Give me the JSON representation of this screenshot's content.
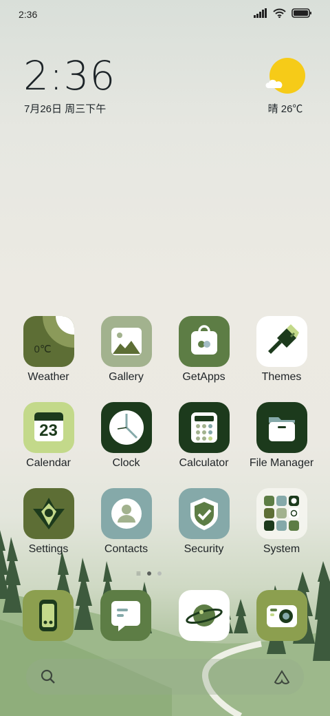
{
  "status_bar": {
    "time": "2:36",
    "icons": [
      "signal-icon",
      "wifi-icon",
      "battery-icon"
    ]
  },
  "clock": {
    "time": "2:36",
    "date": "7月26日 周三下午"
  },
  "weather": {
    "condition_temp": "晴 26℃",
    "icon": "sunny-icon"
  },
  "apps": [
    {
      "label": "Weather",
      "icon_text": "0℃"
    },
    {
      "label": "Gallery"
    },
    {
      "label": "GetApps"
    },
    {
      "label": "Themes"
    },
    {
      "label": "Calendar",
      "icon_text": "23"
    },
    {
      "label": "Clock"
    },
    {
      "label": "Calculator"
    },
    {
      "label": "File Manager"
    },
    {
      "label": "Settings"
    },
    {
      "label": "Contacts"
    },
    {
      "label": "Security"
    },
    {
      "label": "System"
    }
  ],
  "dock": [
    "phone-icon",
    "messages-icon",
    "browser-icon",
    "camera-icon"
  ],
  "page_indicator": {
    "pages": 2,
    "active": 1
  },
  "colors": {
    "olive": "#5d6e35",
    "sage": "#a2b28e",
    "green": "#5d7d45",
    "dark": "#1c3a1c",
    "lime": "#c3d98a",
    "teal": "#85a9a9",
    "yellow": "#f6cb18"
  }
}
